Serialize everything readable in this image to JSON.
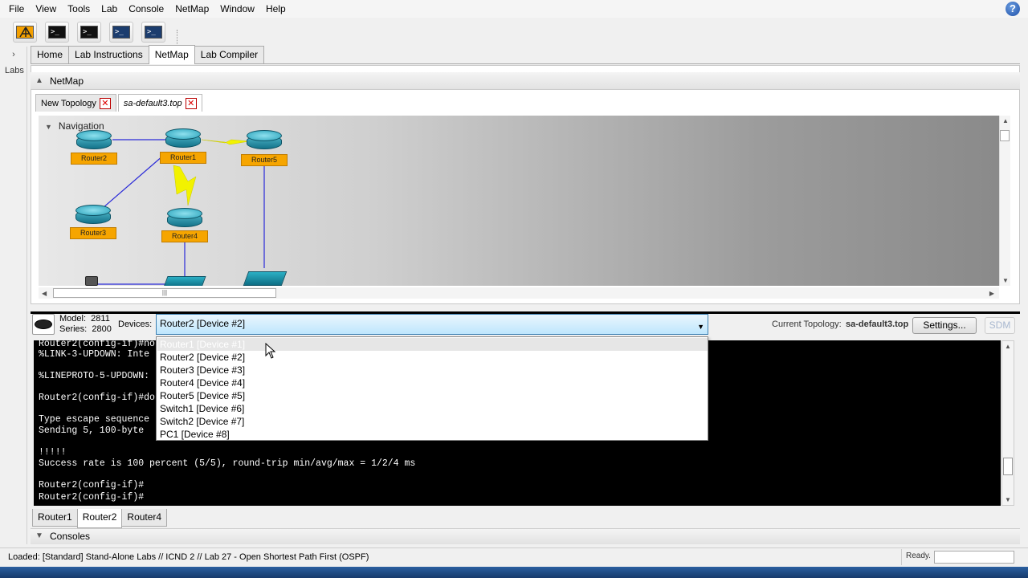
{
  "menubar": {
    "items": [
      "File",
      "View",
      "Tools",
      "Lab",
      "Console",
      "NetMap",
      "Window",
      "Help"
    ],
    "help_icon": "?"
  },
  "toolbar": {
    "buttons": [
      {
        "icon": "netmap-icon",
        "glyph": ""
      },
      {
        "icon": "console-icon",
        "glyph": ">_"
      },
      {
        "icon": "multi-console-icon",
        "glyph": ">_"
      },
      {
        "icon": "console-connect-icon",
        "glyph": ">_"
      },
      {
        "icon": "console-disconnect-icon",
        "glyph": ">_"
      }
    ]
  },
  "sidebar": {
    "label": "Labs",
    "arrow": "›"
  },
  "main_tabs": [
    {
      "label": "Home",
      "active": false
    },
    {
      "label": "Lab Instructions",
      "active": false
    },
    {
      "label": "NetMap",
      "active": true
    },
    {
      "label": "Lab Compiler",
      "active": false
    }
  ],
  "netmap": {
    "title": "NetMap",
    "topology_tabs": [
      {
        "label": "New Topology",
        "active": false
      },
      {
        "label": "sa-default3.top",
        "active": true
      }
    ],
    "navigation_label": "Navigation",
    "devices": [
      "Router2",
      "Router1",
      "Router5",
      "Router3",
      "Router4"
    ],
    "scroll_grip": "|||"
  },
  "console": {
    "model_label": "Model:",
    "model_value": "2811",
    "series_label": "Series:",
    "series_value": "2800",
    "devices_label": "Devices:",
    "selected_device": "Router2  [Device #2]",
    "current_topology_label": "Current Topology:",
    "current_topology_value": "sa-default3.top",
    "settings_label": "Settings...",
    "sdm_label": "SDM",
    "terminal_lines": [
      "Router2(config-if)#no",
      "%LINK-3-UPDOWN: Inte",
      "",
      "%LINEPROTO-5-UPDOWN:",
      "",
      "Router2(config-if)#do",
      "",
      "Type escape sequence",
      "Sending 5, 100-byte",
      "",
      "!!!!!",
      "Success rate is 100 percent (5/5), round-trip min/avg/max = 1/2/4 ms",
      "",
      "Router2(config-if)#",
      "Router2(config-if)#"
    ],
    "dropdown_options": [
      "Router1  [Device #1]",
      "Router2  [Device #2]",
      "Router3  [Device #3]",
      "Router4  [Device #4]",
      "Router5  [Device #5]",
      "Switch1  [Device #6]",
      "Switch2  [Device #7]",
      "PC1  [Device #8]"
    ],
    "console_tabs": [
      {
        "label": "Router1",
        "active": false
      },
      {
        "label": "Router2",
        "active": true
      },
      {
        "label": "Router4",
        "active": false
      }
    ],
    "consoles_title": "Consoles"
  },
  "status": {
    "loaded_text": "Loaded: [Standard] Stand-Alone Labs // ICND 2 // Lab 27 - Open Shortest Path First (OSPF)",
    "ready_text": "Ready."
  },
  "colors": {
    "router_label_bg": "#f6a500",
    "link_blue": "#2a2ad8",
    "serial_yellow": "#f2f200",
    "dropdown_selected_border": "#3c7fb1"
  }
}
